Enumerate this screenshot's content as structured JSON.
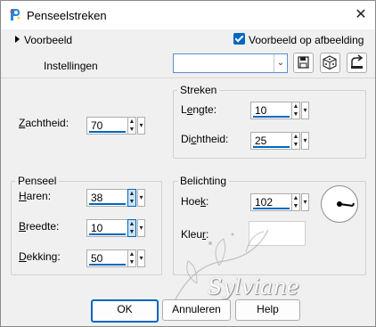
{
  "window": {
    "title": "Penseelstreken"
  },
  "top": {
    "preview_label": "Voorbeeld",
    "preview_on_image_label": "Voorbeeld op afbeelding",
    "preview_on_image_checked": true,
    "settings_label": "Instellingen",
    "settings_value": ""
  },
  "brush_group": {
    "softness_label": "Zachtheid:",
    "softness_value": "70",
    "title": "Penseel",
    "hairs_label": "Haren:",
    "hairs_value": "38",
    "width_label": "Breedte:",
    "width_value": "10",
    "opacity_label": "Dekking:",
    "opacity_value": "50"
  },
  "strokes_group": {
    "title": "Streken",
    "length_label": "Lengte:",
    "length_value": "10",
    "density_label": "Dichtheid:",
    "density_value": "25"
  },
  "lighting_group": {
    "title": "Belichting",
    "angle_label": "Hoek:",
    "angle_value": "102",
    "color_label": "Kleur:",
    "color_value": "#ffffff"
  },
  "watermark": {
    "text": "Sylviane"
  },
  "buttons": {
    "ok": "OK",
    "cancel": "Annuleren",
    "help": "Help"
  },
  "colors": {
    "accent": "#0067c0",
    "panel": "#f0f0f0"
  },
  "icons": [
    "app-icon",
    "close-icon",
    "triangle-right-icon",
    "checkbox-checked-icon",
    "chevron-down-icon",
    "save-icon",
    "randomize-dice-icon",
    "reset-icon",
    "spin-up-icon",
    "spin-down-icon",
    "dropdown-icon",
    "angle-dial-icon"
  ]
}
